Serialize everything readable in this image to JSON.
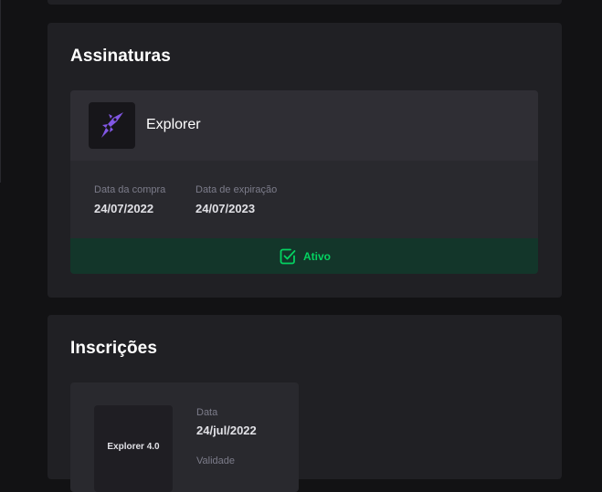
{
  "subscriptions": {
    "title": "Assinaturas",
    "plan_name": "Explorer",
    "purchase_label": "Data da compra",
    "purchase_date": "24/07/2022",
    "expiration_label": "Data de expiração",
    "expiration_date": "24/07/2023",
    "status_label": "Ativo",
    "status_color": "#04d361",
    "logo_icon": "rocket-icon",
    "logo_color": "#8257e5"
  },
  "enrollments": {
    "title": "Inscrições",
    "thumb_label": "Explorer 4.0",
    "date_label": "Data",
    "date_value": "24/jul/2022",
    "validity_label": "Validade"
  }
}
